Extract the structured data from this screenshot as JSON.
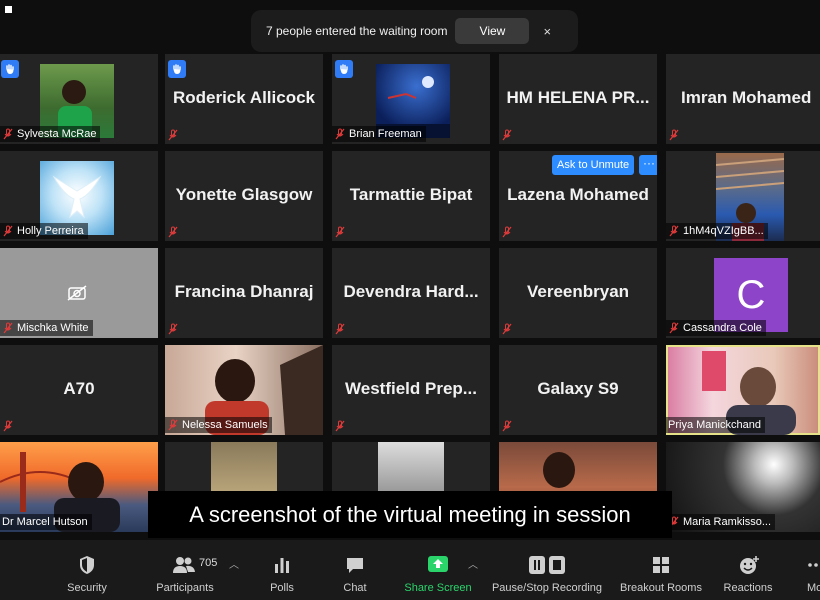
{
  "notification": {
    "text": "7 people entered the waiting room",
    "view_label": "View",
    "close_symbol": "×"
  },
  "caption": "A screenshot of the virtual meeting in session",
  "tiles": {
    "r1c1": "Sylvesta McRae",
    "r1c2": "Roderick Allicock",
    "r1c3": "Brian Freeman",
    "r1c4": "HM  HELENA  PR...",
    "r1c5": "Imran Mohamed",
    "r2c1": "Holly Perreira",
    "r2c2": "Yonette Glasgow",
    "r2c3": "Tarmattie Bipat",
    "r2c4": "Lazena Mohamed",
    "r2c5": "1hM4qVZIgBB...",
    "r3c1": "Mischka White",
    "r3c2": "Francina Dhanraj",
    "r3c3": "Devendra  Hard...",
    "r3c4": "Vereenbryan",
    "r3c5": "Cassandra Cole",
    "r3c5_avatar": "C",
    "r4c1": "A70",
    "r4c2": "Nelessa Samuels",
    "r4c3": "Westfield  Prep...",
    "r4c4": "Galaxy S9",
    "r4c5": "Priya Manickchand",
    "r5c1": "Dr Marcel Hutson",
    "r5c5": "Maria Ramkisso..."
  },
  "unmute": {
    "ask_label": "Ask to Unmute",
    "more_label": "···"
  },
  "toolbar": {
    "security": "Security",
    "participants": "Participants",
    "participants_count": "705",
    "polls": "Polls",
    "chat": "Chat",
    "share_screen": "Share Screen",
    "recording": "Pause/Stop Recording",
    "breakout": "Breakout Rooms",
    "reactions": "Reactions",
    "more": "Mo"
  },
  "colors": {
    "accent": "#2d8cff",
    "share_green": "#2bd46b",
    "speaker_outline": "#e6e28a",
    "muted_red": "#e03a3a"
  }
}
